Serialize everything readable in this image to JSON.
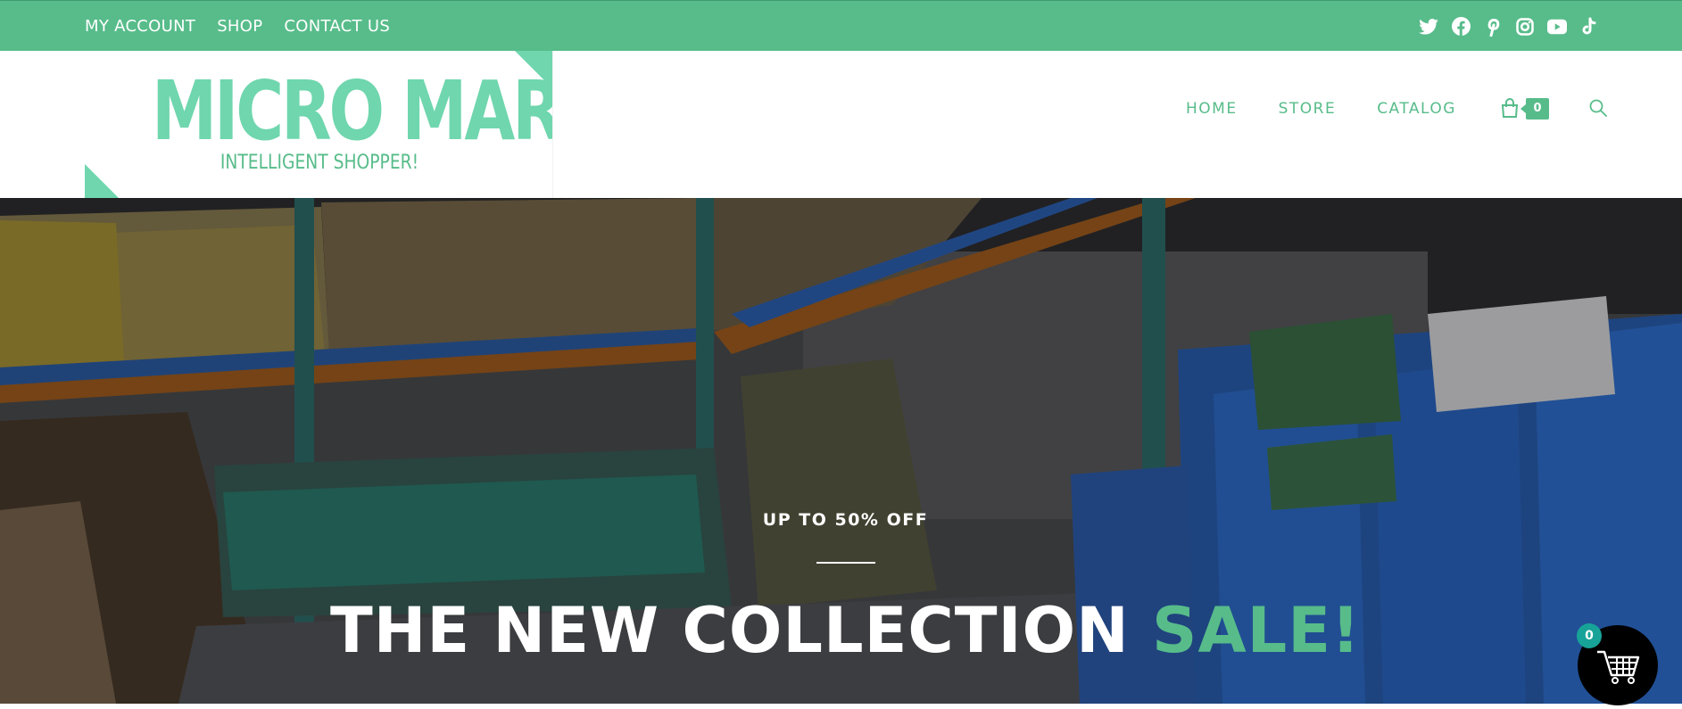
{
  "top_nav": {
    "items": [
      "MY ACCOUNT",
      "SHOP",
      "CONTACT US"
    ]
  },
  "social_icons": [
    "twitter-icon",
    "facebook-icon",
    "pinterest-icon",
    "instagram-icon",
    "youtube-icon",
    "tiktok-icon"
  ],
  "logo": {
    "title": "MICRO MART",
    "tagline": "INTELLIGENT SHOPPER!"
  },
  "main_nav": {
    "items": [
      "HOME",
      "STORE",
      "CATALOG"
    ],
    "cart_count": "0",
    "icons": [
      "shopping-bag-icon",
      "search-icon"
    ]
  },
  "hero": {
    "subtitle": "UP TO 50% OFF",
    "title": "THE NEW COLLECTION",
    "title_accent": "SALE!"
  },
  "floating_cart": {
    "count": "0",
    "icon": "shopping-cart-icon"
  },
  "colors": {
    "brand_green": "#57bc8a",
    "logo_mint": "#6fd6ae",
    "badge_teal": "#17a398"
  }
}
